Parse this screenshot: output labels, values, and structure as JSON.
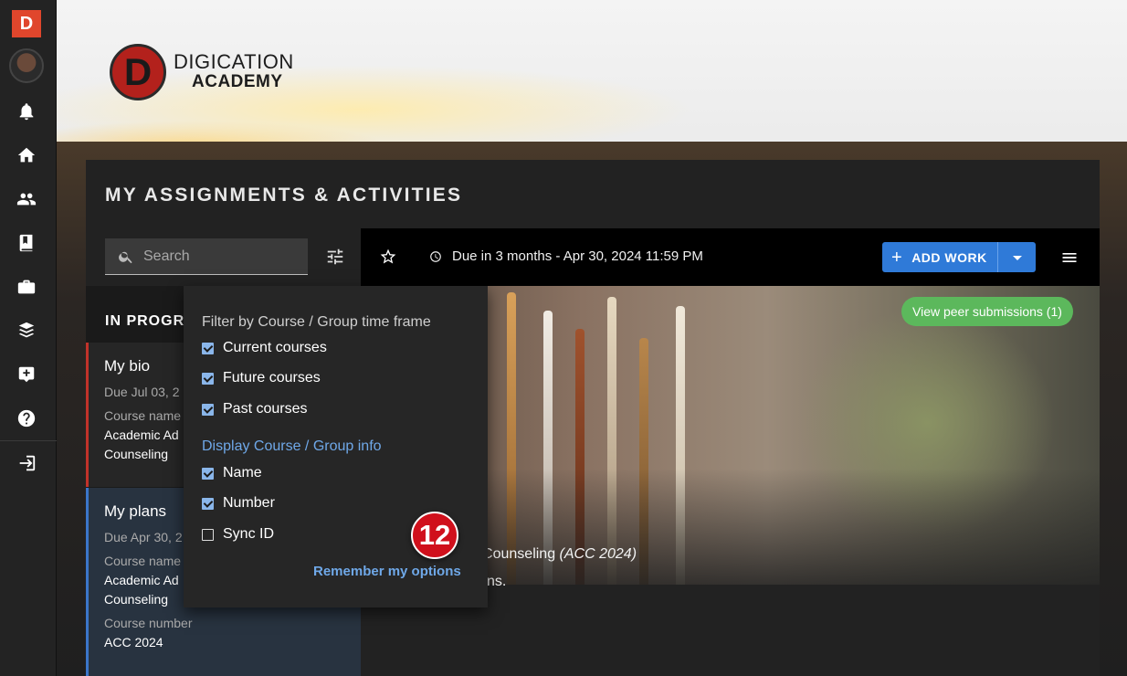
{
  "app": {
    "logo_letter": "D"
  },
  "brand": {
    "mark": "D",
    "line1": "DIGICATION",
    "line2": "ACADEMY"
  },
  "rail": {
    "icons": [
      "bell-icon",
      "home-icon",
      "people-icon",
      "book-icon",
      "briefcase-icon",
      "layers-icon",
      "add-box-icon",
      "help-icon",
      "logout-icon"
    ]
  },
  "panel": {
    "title": "MY ASSIGNMENTS & ACTIVITIES"
  },
  "search": {
    "placeholder": "Search"
  },
  "toolbar": {
    "due": "Due in 3 months - Apr 30, 2024 11:59 PM",
    "add_work": "ADD WORK"
  },
  "hero": {
    "peer_button": "View peer submissions (1)"
  },
  "detail": {
    "course_prefix": "sing / Career Counseling ",
    "course_code": "(ACC 2024)",
    "desc_fragment": "ns."
  },
  "list": {
    "heading": "IN PROGR",
    "cards": [
      {
        "title": "My bio",
        "due": "Due Jul 03, 2",
        "course_label": "Course name",
        "course_value_1": "Academic Ad",
        "course_value_2": "Counseling"
      },
      {
        "title": "My plans",
        "due": "Due Apr 30, 2",
        "course_label": "Course name",
        "course_value_1": "Academic Ad",
        "course_value_2": "Counseling",
        "number_label": "Course number",
        "number_value": "ACC 2024"
      }
    ]
  },
  "filter": {
    "heading_timeframe": "Filter by Course / Group time frame",
    "timeframe": [
      {
        "label": "Current courses",
        "checked": true
      },
      {
        "label": "Future courses",
        "checked": true
      },
      {
        "label": "Past courses",
        "checked": true
      }
    ],
    "heading_display": "Display Course / Group info",
    "display": [
      {
        "label": "Name",
        "checked": true
      },
      {
        "label": "Number",
        "checked": true
      },
      {
        "label": "Sync ID",
        "checked": false
      }
    ],
    "remember": "Remember my options"
  },
  "step_badge": "12",
  "colors": {
    "accent_blue": "#2f7ad8",
    "link_blue": "#6fa8e8",
    "success_green": "#5cb85c",
    "brand_red": "#e0462c",
    "badge_red": "#d0101c"
  }
}
